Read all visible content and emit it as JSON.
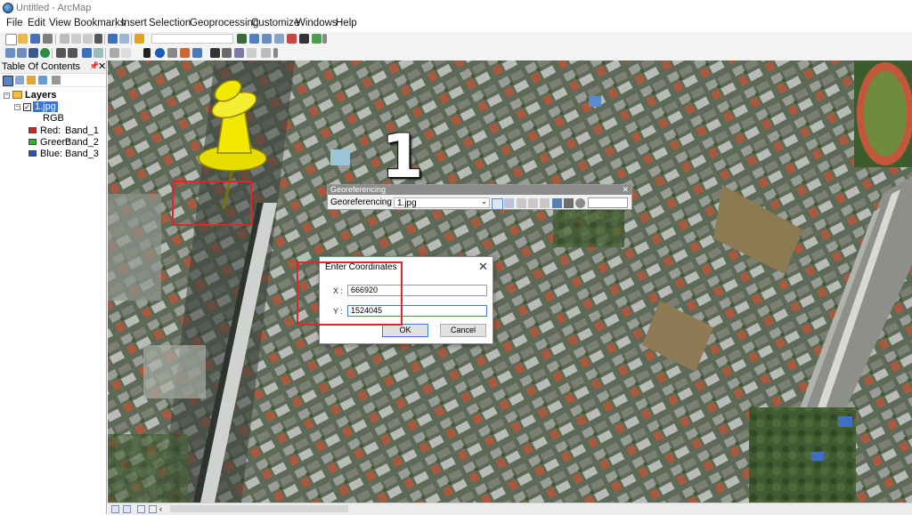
{
  "window": {
    "title": "Untitled - ArcMap"
  },
  "menu": [
    "File",
    "Edit",
    "View",
    "Bookmarks",
    "Insert",
    "Selection",
    "Geoprocessing",
    "Customize",
    "Windows",
    "Help"
  ],
  "toc": {
    "title": "Table Of Contents",
    "root": "Layers",
    "layer": "1.jpg",
    "render_type": "RGB",
    "bands": [
      {
        "label": "Red:",
        "band": "Band_1",
        "color": "#d42020"
      },
      {
        "label": "Green:",
        "band": "Band_2",
        "color": "#22bb22"
      },
      {
        "label": "Blue:",
        "band": "Band_3",
        "color": "#2255cc"
      }
    ]
  },
  "georef_toolbar": {
    "title": "Georeferencing",
    "menu_label": "Georeferencing",
    "layer": "1.jpg"
  },
  "dialog": {
    "title": "Enter Coordinates",
    "x_label": "X :",
    "x_value": "666920",
    "y_label": "Y :",
    "y_value": "1524045",
    "ok_label": "OK",
    "cancel_label": "Cancel"
  },
  "annotation": {
    "number": "1",
    "pin_color": "#f2e800",
    "highlight_color": "#e0252c"
  }
}
